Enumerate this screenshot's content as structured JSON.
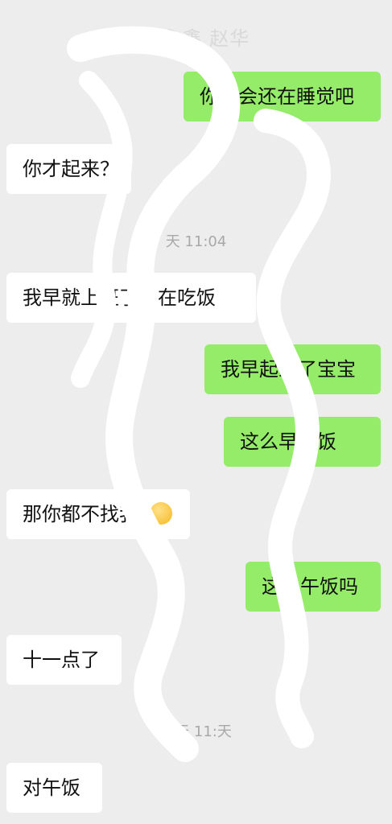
{
  "header": {
    "title": "杨永鑫 赵华"
  },
  "messages": [
    {
      "side": "out",
      "text": "你不会还在睡觉吧"
    },
    {
      "side": "in",
      "text": "你才起来？"
    },
    {
      "type": "time",
      "text": "天 11:04"
    },
    {
      "side": "in",
      "text": "我早就上班了。在吃饭"
    },
    {
      "side": "out",
      "text": "我早起来了宝宝"
    },
    {
      "side": "out",
      "text": "这么早吃饭"
    },
    {
      "side": "in",
      "text": "那你都不找我",
      "emoji": "thinking-face-emoji"
    },
    {
      "side": "out",
      "text": "这是午饭吗"
    },
    {
      "side": "in",
      "text": "十一点了"
    },
    {
      "type": "time",
      "text": "昨天 11:天"
    },
    {
      "side": "in",
      "text": "对午饭"
    }
  ],
  "colors": {
    "background": "#ededed",
    "incoming_bubble": "#ffffff",
    "outgoing_bubble": "#95ec69",
    "timestamp": "#a8a8a8",
    "scribble": "#ffffff"
  }
}
